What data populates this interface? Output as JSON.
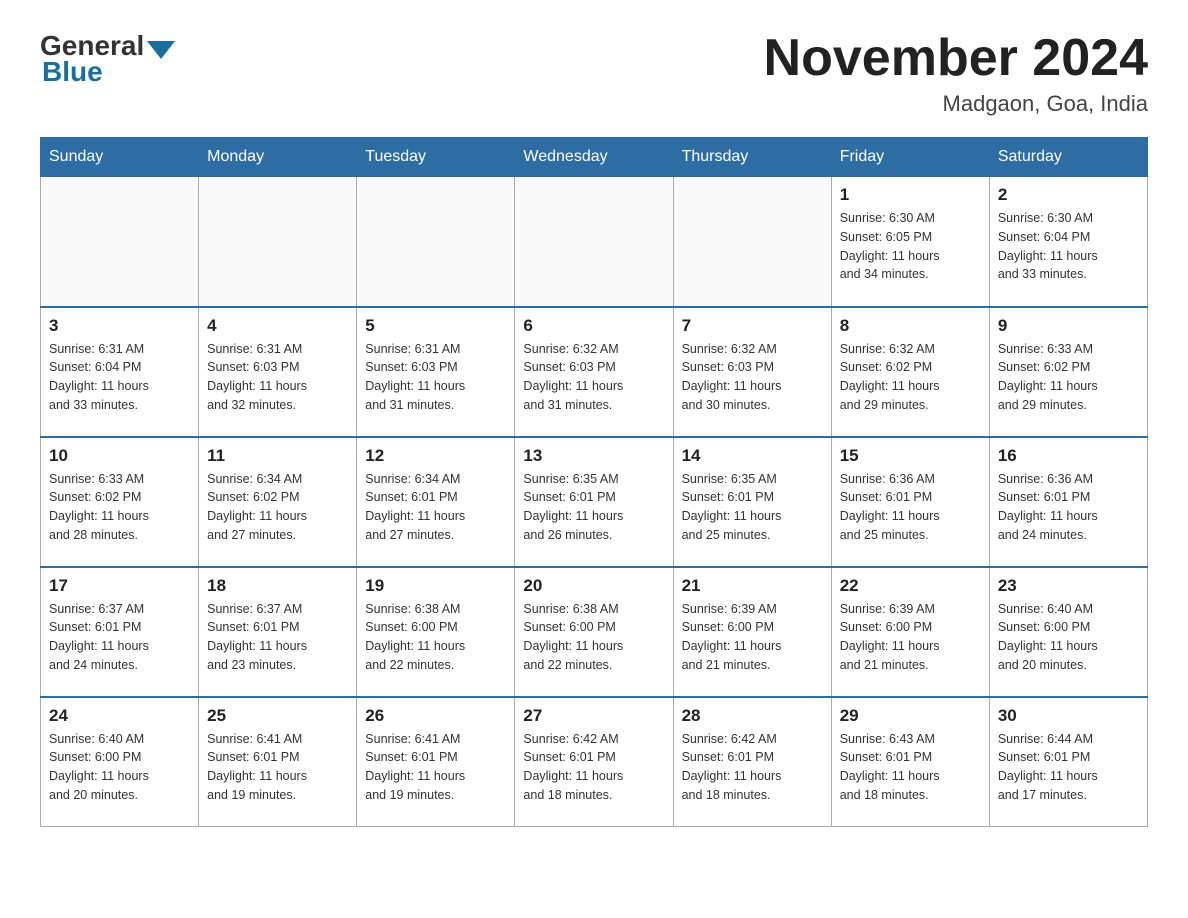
{
  "header": {
    "logo_general": "General",
    "logo_blue": "Blue",
    "month_title": "November 2024",
    "location": "Madgaon, Goa, India"
  },
  "weekdays": [
    "Sunday",
    "Monday",
    "Tuesday",
    "Wednesday",
    "Thursday",
    "Friday",
    "Saturday"
  ],
  "weeks": [
    [
      {
        "day": "",
        "info": ""
      },
      {
        "day": "",
        "info": ""
      },
      {
        "day": "",
        "info": ""
      },
      {
        "day": "",
        "info": ""
      },
      {
        "day": "",
        "info": ""
      },
      {
        "day": "1",
        "info": "Sunrise: 6:30 AM\nSunset: 6:05 PM\nDaylight: 11 hours\nand 34 minutes."
      },
      {
        "day": "2",
        "info": "Sunrise: 6:30 AM\nSunset: 6:04 PM\nDaylight: 11 hours\nand 33 minutes."
      }
    ],
    [
      {
        "day": "3",
        "info": "Sunrise: 6:31 AM\nSunset: 6:04 PM\nDaylight: 11 hours\nand 33 minutes."
      },
      {
        "day": "4",
        "info": "Sunrise: 6:31 AM\nSunset: 6:03 PM\nDaylight: 11 hours\nand 32 minutes."
      },
      {
        "day": "5",
        "info": "Sunrise: 6:31 AM\nSunset: 6:03 PM\nDaylight: 11 hours\nand 31 minutes."
      },
      {
        "day": "6",
        "info": "Sunrise: 6:32 AM\nSunset: 6:03 PM\nDaylight: 11 hours\nand 31 minutes."
      },
      {
        "day": "7",
        "info": "Sunrise: 6:32 AM\nSunset: 6:03 PM\nDaylight: 11 hours\nand 30 minutes."
      },
      {
        "day": "8",
        "info": "Sunrise: 6:32 AM\nSunset: 6:02 PM\nDaylight: 11 hours\nand 29 minutes."
      },
      {
        "day": "9",
        "info": "Sunrise: 6:33 AM\nSunset: 6:02 PM\nDaylight: 11 hours\nand 29 minutes."
      }
    ],
    [
      {
        "day": "10",
        "info": "Sunrise: 6:33 AM\nSunset: 6:02 PM\nDaylight: 11 hours\nand 28 minutes."
      },
      {
        "day": "11",
        "info": "Sunrise: 6:34 AM\nSunset: 6:02 PM\nDaylight: 11 hours\nand 27 minutes."
      },
      {
        "day": "12",
        "info": "Sunrise: 6:34 AM\nSunset: 6:01 PM\nDaylight: 11 hours\nand 27 minutes."
      },
      {
        "day": "13",
        "info": "Sunrise: 6:35 AM\nSunset: 6:01 PM\nDaylight: 11 hours\nand 26 minutes."
      },
      {
        "day": "14",
        "info": "Sunrise: 6:35 AM\nSunset: 6:01 PM\nDaylight: 11 hours\nand 25 minutes."
      },
      {
        "day": "15",
        "info": "Sunrise: 6:36 AM\nSunset: 6:01 PM\nDaylight: 11 hours\nand 25 minutes."
      },
      {
        "day": "16",
        "info": "Sunrise: 6:36 AM\nSunset: 6:01 PM\nDaylight: 11 hours\nand 24 minutes."
      }
    ],
    [
      {
        "day": "17",
        "info": "Sunrise: 6:37 AM\nSunset: 6:01 PM\nDaylight: 11 hours\nand 24 minutes."
      },
      {
        "day": "18",
        "info": "Sunrise: 6:37 AM\nSunset: 6:01 PM\nDaylight: 11 hours\nand 23 minutes."
      },
      {
        "day": "19",
        "info": "Sunrise: 6:38 AM\nSunset: 6:00 PM\nDaylight: 11 hours\nand 22 minutes."
      },
      {
        "day": "20",
        "info": "Sunrise: 6:38 AM\nSunset: 6:00 PM\nDaylight: 11 hours\nand 22 minutes."
      },
      {
        "day": "21",
        "info": "Sunrise: 6:39 AM\nSunset: 6:00 PM\nDaylight: 11 hours\nand 21 minutes."
      },
      {
        "day": "22",
        "info": "Sunrise: 6:39 AM\nSunset: 6:00 PM\nDaylight: 11 hours\nand 21 minutes."
      },
      {
        "day": "23",
        "info": "Sunrise: 6:40 AM\nSunset: 6:00 PM\nDaylight: 11 hours\nand 20 minutes."
      }
    ],
    [
      {
        "day": "24",
        "info": "Sunrise: 6:40 AM\nSunset: 6:00 PM\nDaylight: 11 hours\nand 20 minutes."
      },
      {
        "day": "25",
        "info": "Sunrise: 6:41 AM\nSunset: 6:01 PM\nDaylight: 11 hours\nand 19 minutes."
      },
      {
        "day": "26",
        "info": "Sunrise: 6:41 AM\nSunset: 6:01 PM\nDaylight: 11 hours\nand 19 minutes."
      },
      {
        "day": "27",
        "info": "Sunrise: 6:42 AM\nSunset: 6:01 PM\nDaylight: 11 hours\nand 18 minutes."
      },
      {
        "day": "28",
        "info": "Sunrise: 6:42 AM\nSunset: 6:01 PM\nDaylight: 11 hours\nand 18 minutes."
      },
      {
        "day": "29",
        "info": "Sunrise: 6:43 AM\nSunset: 6:01 PM\nDaylight: 11 hours\nand 18 minutes."
      },
      {
        "day": "30",
        "info": "Sunrise: 6:44 AM\nSunset: 6:01 PM\nDaylight: 11 hours\nand 17 minutes."
      }
    ]
  ]
}
